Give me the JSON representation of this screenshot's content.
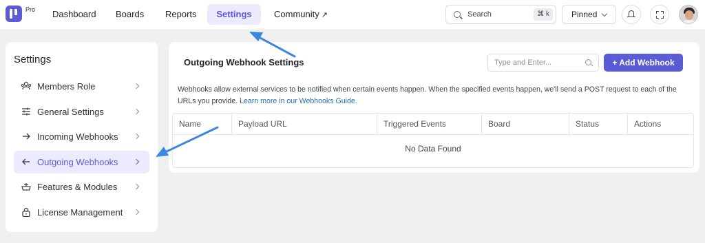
{
  "topbar": {
    "badge": "Pro",
    "nav": [
      "Dashboard",
      "Boards",
      "Reports",
      "Settings",
      "Community"
    ],
    "active_nav": "Settings",
    "external_glyph": "↗",
    "search_label": "Search",
    "search_shortcut": "⌘ k",
    "pinned_label": "Pinned"
  },
  "sidebar": {
    "title": "Settings",
    "items": [
      {
        "label": "Members Role",
        "icon": "users-icon"
      },
      {
        "label": "General Settings",
        "icon": "sliders-icon"
      },
      {
        "label": "Incoming Webhooks",
        "icon": "arrow-right-icon"
      },
      {
        "label": "Outgoing Webhooks",
        "icon": "arrow-left-icon",
        "active": true
      },
      {
        "label": "Features & Modules",
        "icon": "modules-icon"
      },
      {
        "label": "License Management",
        "icon": "lock-icon"
      }
    ]
  },
  "main": {
    "title": "Outgoing Webhook Settings",
    "filter_placeholder": "Type and Enter...",
    "add_button": "+ Add Webhook",
    "description": "Webhooks allow external services to be notified when certain events happen. When the specified events happen, we'll send a POST request to each of the URLs you provide.",
    "link_text": "Learn more in our Webhooks Guide.",
    "table": {
      "columns": [
        "Name",
        "Payload URL",
        "Triggered Events",
        "Board",
        "Status",
        "Actions"
      ],
      "empty_text": "No Data Found"
    }
  },
  "colors": {
    "accent": "#5b5bd6",
    "accent_bg": "#eceaff",
    "link": "#2271b1",
    "annotation_arrow": "#3b86e0"
  }
}
